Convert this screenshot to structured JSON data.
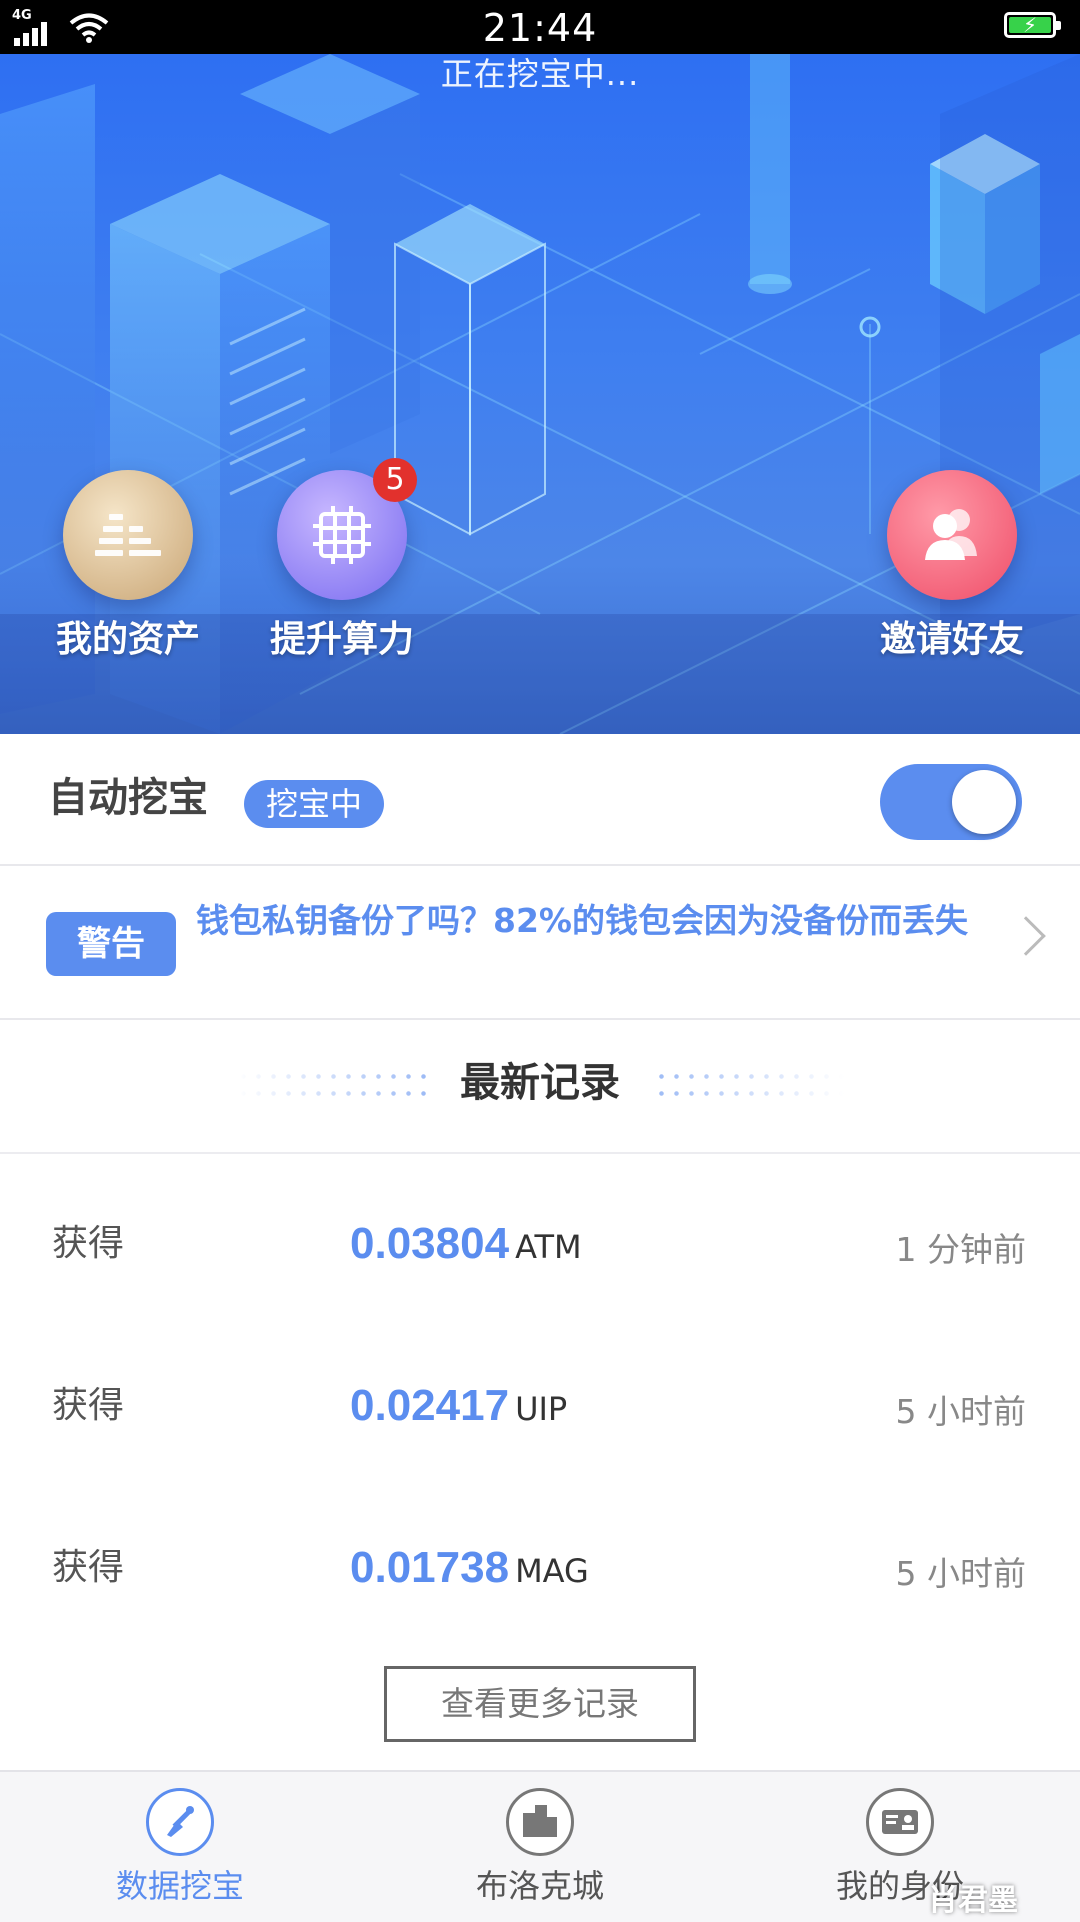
{
  "status_bar": {
    "network": "4G",
    "time": "21:44"
  },
  "hero": {
    "status": "正在挖宝中...",
    "buttons": [
      {
        "label": "我的资产",
        "icon": "assets-icon"
      },
      {
        "label": "提升算力",
        "icon": "chip-icon",
        "badge": "5"
      },
      {
        "label": "邀请好友",
        "icon": "friends-icon"
      }
    ]
  },
  "auto_mine": {
    "title": "自动挖宝",
    "status_pill": "挖宝中",
    "enabled": true
  },
  "warning": {
    "tag": "警告",
    "message": "钱包私钥备份了吗？82%的钱包会因为没备份而丢失"
  },
  "records": {
    "title": "最新记录",
    "items": [
      {
        "label": "获得",
        "amount": "0.03804",
        "unit": "ATM",
        "time": "1 分钟前"
      },
      {
        "label": "获得",
        "amount": "0.02417",
        "unit": "UIP",
        "time": "5 小时前"
      },
      {
        "label": "获得",
        "amount": "0.01738",
        "unit": "MAG",
        "time": "5 小时前"
      }
    ],
    "more_button": "查看更多记录"
  },
  "bottom_nav": {
    "items": [
      {
        "label": "数据挖宝",
        "icon": "shovel-icon",
        "active": true
      },
      {
        "label": "布洛克城",
        "icon": "city-icon",
        "active": false
      },
      {
        "label": "我的身份",
        "icon": "id-card-icon",
        "active": false
      }
    ]
  },
  "watermark": "肖君墨",
  "colors": {
    "accent": "#5b8def",
    "badge": "#e2312d",
    "battery": "#37d24a"
  }
}
